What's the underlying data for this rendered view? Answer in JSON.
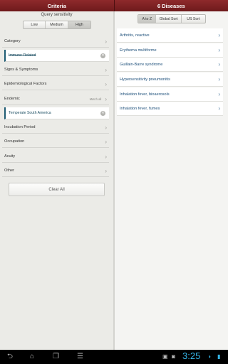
{
  "header": {
    "left_title": "Criteria",
    "right_title": "6 Diseases"
  },
  "query": {
    "label": "Query sensitivity",
    "options": [
      "Low",
      "Medium",
      "High"
    ],
    "selected": "High"
  },
  "criteria": {
    "category": {
      "label": "Category",
      "chip": "Immune-Related"
    },
    "signs": {
      "label": "Signs & Symptoms"
    },
    "epidemiological": {
      "label": "Epidemiological Factors"
    },
    "endemic": {
      "label": "Endemic",
      "hint": "Match all",
      "chip": "Temperate South America"
    },
    "incubation": {
      "label": "Incubation Period"
    },
    "occupation": {
      "label": "Occupation"
    },
    "acuity": {
      "label": "Acuity"
    },
    "other": {
      "label": "Other"
    },
    "clear_label": "Clear All"
  },
  "sort": {
    "options": [
      "A to Z",
      "Global Sort",
      "US Sort"
    ],
    "selected": "A to Z"
  },
  "diseases": [
    "Arthritis, reactive",
    "Erythema multiforme",
    "Guillain-Barre syndrome",
    "Hypersensitivity pneumonitis",
    "Inhalation fever, bioaerosols",
    "Inhalation fever, fumes"
  ],
  "statusbar": {
    "time": "3:25"
  }
}
